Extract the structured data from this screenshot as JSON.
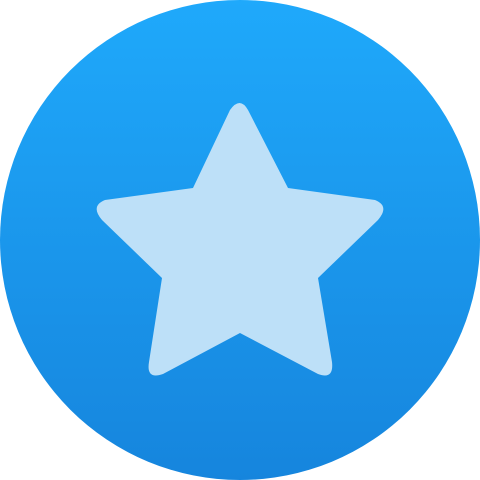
{
  "icon": {
    "name": "star-icon",
    "colors": {
      "circle_top": "#1fa9fb",
      "circle_bottom": "#1685dd",
      "star_fill": "#bde0f8"
    }
  }
}
